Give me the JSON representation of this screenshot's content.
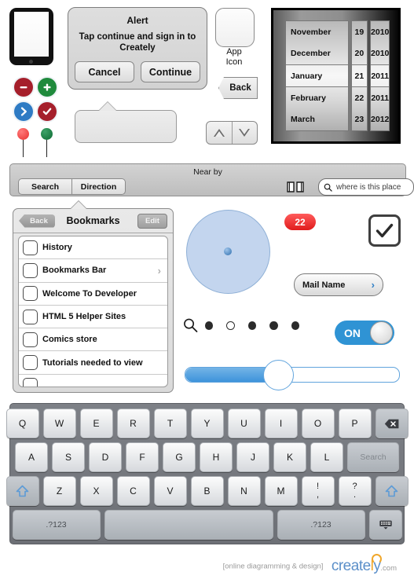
{
  "tablet": {
    "name": "tablet-device"
  },
  "alert": {
    "title": "Alert",
    "message": "Tap continue and sign in to Creately",
    "cancel_label": "Cancel",
    "continue_label": "Continue"
  },
  "icons": {
    "minus": "minus-circle-icon",
    "plus": "plus-circle-icon",
    "chevron": "chevron-right-circle-icon",
    "check": "check-circle-icon",
    "pin_red": "map-pin-red-icon",
    "pin_green": "map-pin-green-icon",
    "colors": {
      "red": "#a51f2b",
      "green": "#1f8a3c",
      "blue": "#2e7bc4",
      "pin_red": "#ef3a3a",
      "pin_green": "#13723a"
    }
  },
  "app_icon": {
    "line1": "App",
    "line2": "Icon"
  },
  "back_button": {
    "label": "Back"
  },
  "stepper": {
    "up": "triangle-up-icon",
    "down": "triangle-down-icon"
  },
  "date_picker": {
    "rows": [
      {
        "month": "November",
        "day": "19",
        "year": "2010",
        "selected": false
      },
      {
        "month": "December",
        "day": "20",
        "year": "2010",
        "selected": false
      },
      {
        "month": "January",
        "day": "21",
        "year": "2011",
        "selected": true
      },
      {
        "month": "February",
        "day": "22",
        "year": "2011",
        "selected": false
      },
      {
        "month": "March",
        "day": "23",
        "year": "2012",
        "selected": false
      }
    ]
  },
  "toolbar": {
    "title": "Near by",
    "segment_search": "Search",
    "segment_direction": "Direction",
    "book_icon": "open-book-icon",
    "search_placeholder": "where is this place"
  },
  "bookmarks": {
    "back_label": "Back",
    "title": "Bookmarks",
    "edit_label": "Edit",
    "items": [
      {
        "label": "History",
        "chevron": false
      },
      {
        "label": "Bookmarks Bar",
        "chevron": true
      },
      {
        "label": "Welcome To Developer",
        "chevron": false
      },
      {
        "label": "HTML 5 Helper Sites",
        "chevron": false
      },
      {
        "label": "Comics store",
        "chevron": false
      },
      {
        "label": "Tutorials needed to view",
        "chevron": false
      },
      {
        "label": "",
        "chevron": false
      }
    ]
  },
  "widgets": {
    "badge_count": "22",
    "checkbox_checked": true,
    "mail_label": "Mail Name",
    "page_dots": {
      "total": 5,
      "current_index": 1
    },
    "toggle_label": "ON",
    "slider_percent": "43",
    "accent_blue": "#2f93d4",
    "badge_red": "#e01b1b",
    "dial_fill": "#c3d5ee"
  },
  "keyboard": {
    "row1": [
      "Q",
      "W",
      "E",
      "R",
      "T",
      "Y",
      "U",
      "I",
      "O",
      "P"
    ],
    "backspace": "backspace-icon",
    "row2": [
      "A",
      "S",
      "D",
      "F",
      "G",
      "H",
      "J",
      "K",
      "L"
    ],
    "search_key": "Search",
    "row3": [
      "Z",
      "X",
      "C",
      "V",
      "B",
      "N",
      "M"
    ],
    "shift": "shift-icon",
    "punct1_top": "!",
    "punct1_bottom": ",",
    "punct2_top": "?",
    "punct2_bottom": ".",
    "num_left": ".?123",
    "num_right": ".?123",
    "space": "",
    "hide_keyboard": "hide-keyboard-icon"
  },
  "footer": {
    "tagline": "[online diagramming & design]",
    "brand_part1": "create",
    "brand_part_l": "l",
    "brand_part2": "y",
    "domain": ".com"
  }
}
